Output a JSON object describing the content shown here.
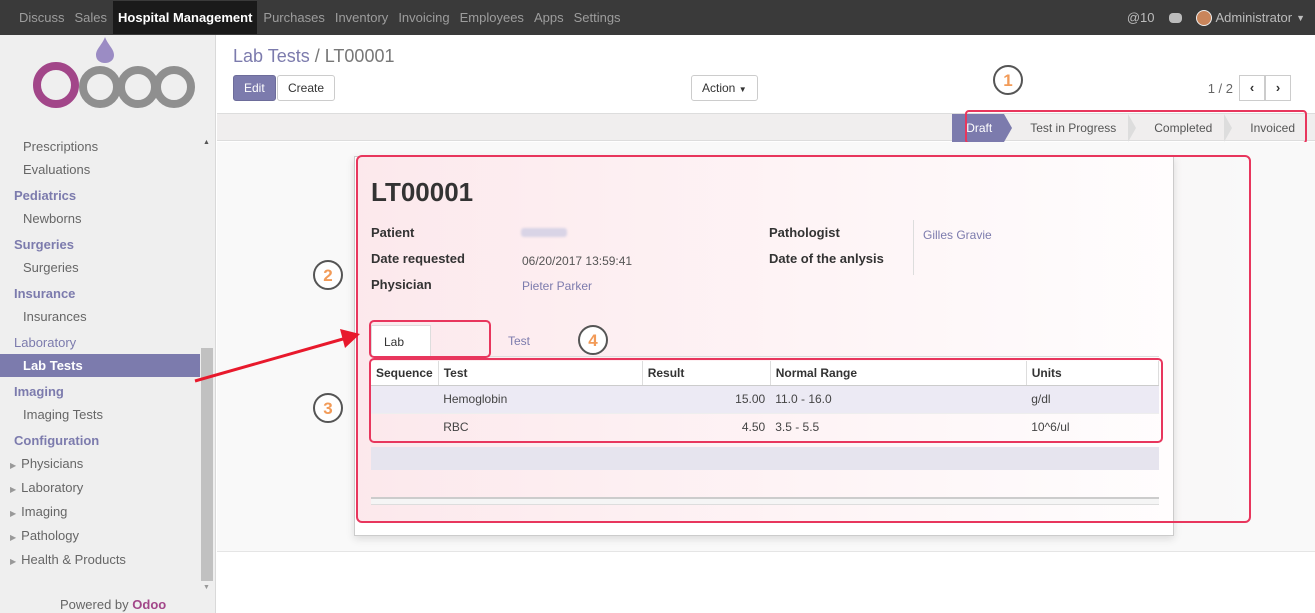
{
  "topbar": {
    "menus": [
      "Discuss",
      "Sales",
      "Hospital Management",
      "Purchases",
      "Inventory",
      "Invoicing",
      "Employees",
      "Apps",
      "Settings"
    ],
    "active_menu": "Hospital Management",
    "notifications": "@10",
    "user": "Administrator"
  },
  "sidebar": {
    "logo_text": "odoo",
    "items": [
      {
        "type": "item",
        "label": "Prescriptions"
      },
      {
        "type": "item",
        "label": "Evaluations"
      },
      {
        "type": "head",
        "label": "Pediatrics"
      },
      {
        "type": "item",
        "label": "Newborns"
      },
      {
        "type": "head",
        "label": "Surgeries"
      },
      {
        "type": "item",
        "label": "Surgeries"
      },
      {
        "type": "head",
        "label": "Insurance"
      },
      {
        "type": "item",
        "label": "Insurances"
      },
      {
        "type": "head",
        "label": "Laboratory"
      },
      {
        "type": "item",
        "label": "Lab Tests",
        "active": true
      },
      {
        "type": "head",
        "label": "Imaging"
      },
      {
        "type": "item",
        "label": "Imaging Tests"
      },
      {
        "type": "head",
        "label": "Configuration"
      },
      {
        "type": "sub",
        "label": "Physicians"
      },
      {
        "type": "sub",
        "label": "Laboratory"
      },
      {
        "type": "sub",
        "label": "Imaging"
      },
      {
        "type": "sub",
        "label": "Pathology"
      },
      {
        "type": "sub",
        "label": "Health & Products"
      }
    ],
    "powered_prefix": "Powered by",
    "powered_brand": "Odoo"
  },
  "breadcrumb": {
    "parent": "Lab Tests",
    "separator": " / ",
    "current": "LT00001"
  },
  "buttons": {
    "edit": "Edit",
    "create": "Create",
    "action": "Action"
  },
  "pager": {
    "value": "1 / 2"
  },
  "stages": [
    {
      "label": "Draft",
      "active": true
    },
    {
      "label": "Test in Progress"
    },
    {
      "label": "Completed"
    },
    {
      "label": "Invoiced"
    }
  ],
  "record": {
    "title": "LT00001",
    "fields": {
      "patient_label": "Patient",
      "date_requested_label": "Date requested",
      "date_requested": "06/20/2017 13:59:41",
      "physician_label": "Physician",
      "physician": "Pieter Parker",
      "pathologist_label": "Pathologist",
      "pathologist": "Gilles Gravie",
      "date_analysis_label": "Date of the anlysis"
    },
    "tabs": [
      "Lab Test Cases",
      "Test Result"
    ],
    "table": {
      "columns": [
        "Sequence",
        "Test",
        "Result",
        "Normal Range",
        "Units"
      ],
      "rows": [
        {
          "sequence": "",
          "test": "Hemoglobin",
          "result": "15.00",
          "range": "11.0 - 16.0",
          "units": "g/dl"
        },
        {
          "sequence": "",
          "test": "RBC",
          "result": "4.50",
          "range": "3.5 - 5.5",
          "units": "10^6/ul"
        }
      ]
    }
  },
  "annotations": [
    "1",
    "2",
    "3",
    "4"
  ],
  "colors": {
    "accent": "#7c7bad",
    "highlight": "#e8365d",
    "badge_number": "#f29b58"
  }
}
